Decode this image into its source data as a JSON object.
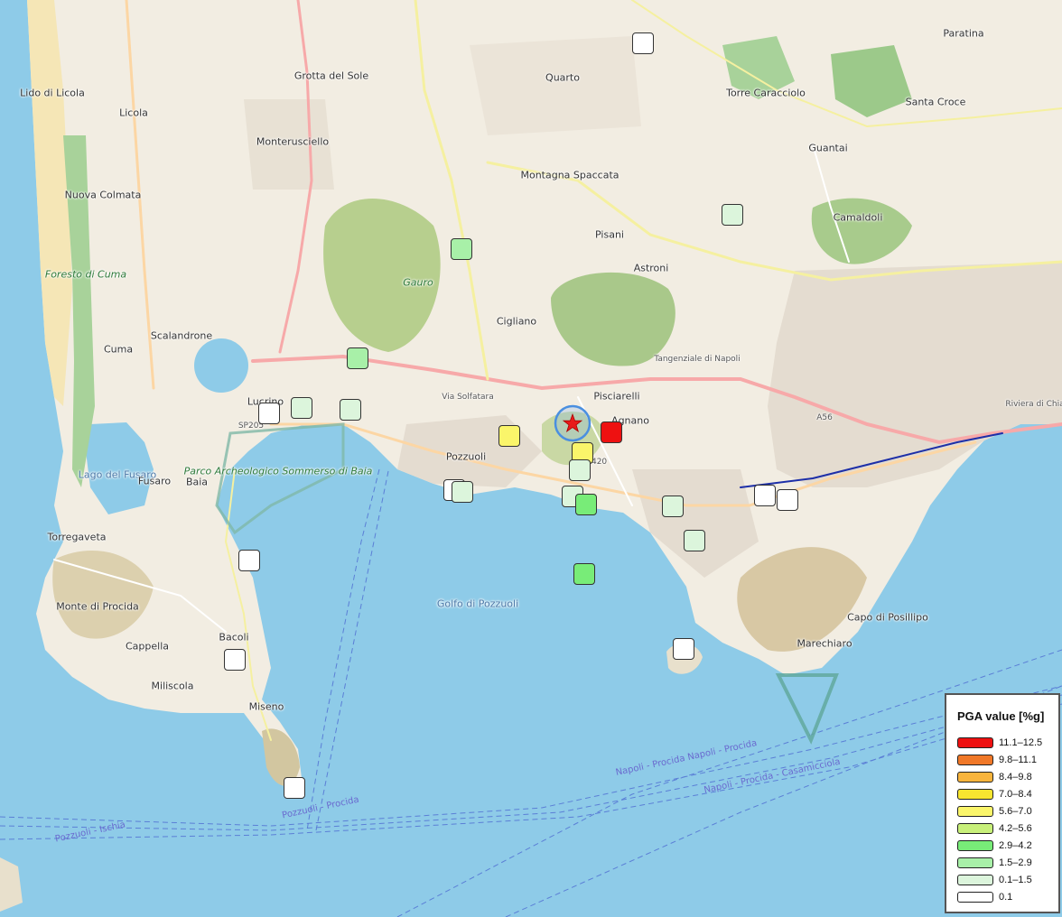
{
  "map": {
    "place_labels": [
      {
        "text": "Lido di Licola",
        "kind": "town"
      },
      {
        "text": "Licola",
        "kind": "town"
      },
      {
        "text": "Grotta del Sole",
        "kind": "town"
      },
      {
        "text": "Quarto",
        "kind": "town"
      },
      {
        "text": "Torre Caracciolo",
        "kind": "town"
      },
      {
        "text": "Paratina",
        "kind": "town"
      },
      {
        "text": "Santa Croce",
        "kind": "town"
      },
      {
        "text": "Monterusciello",
        "kind": "town"
      },
      {
        "text": "Guantai",
        "kind": "town"
      },
      {
        "text": "Montagna Spaccata",
        "kind": "town"
      },
      {
        "text": "Nuova Colmata",
        "kind": "town"
      },
      {
        "text": "Camaldoli",
        "kind": "town"
      },
      {
        "text": "Pisani",
        "kind": "town"
      },
      {
        "text": "Foresto di Cuma",
        "kind": "park"
      },
      {
        "text": "Astroni",
        "kind": "town"
      },
      {
        "text": "Gauro",
        "kind": "park"
      },
      {
        "text": "Cigliano",
        "kind": "town"
      },
      {
        "text": "Scalandrone",
        "kind": "town"
      },
      {
        "text": "Cuma",
        "kind": "town"
      },
      {
        "text": "Pisciarelli",
        "kind": "town"
      },
      {
        "text": "Lucrino",
        "kind": "town"
      },
      {
        "text": "Agnano",
        "kind": "town"
      },
      {
        "text": "Pozzuoli",
        "kind": "town"
      },
      {
        "text": "Parco Archeologico Sommerso di Baia",
        "kind": "park"
      },
      {
        "text": "Lago del Fusaro",
        "kind": "water"
      },
      {
        "text": "Fusaro",
        "kind": "town"
      },
      {
        "text": "Baia",
        "kind": "town"
      },
      {
        "text": "Torregaveta",
        "kind": "town"
      },
      {
        "text": "Golfo di Pozzuoli",
        "kind": "water"
      },
      {
        "text": "Monte di Procida",
        "kind": "town"
      },
      {
        "text": "Bacoli",
        "kind": "town"
      },
      {
        "text": "Cappella",
        "kind": "town"
      },
      {
        "text": "Capo di Posillipo",
        "kind": "town"
      },
      {
        "text": "Marechiaro",
        "kind": "town"
      },
      {
        "text": "Miliscola",
        "kind": "town"
      },
      {
        "text": "Miseno",
        "kind": "town"
      },
      {
        "text": "Napoli - Procida  Napoli - Procida",
        "kind": "route"
      },
      {
        "text": "Napoli - Procida - Casamicciola",
        "kind": "route"
      },
      {
        "text": "Pozzuoli - Ischia",
        "kind": "route"
      },
      {
        "text": "Pozzuoli - Procida",
        "kind": "route"
      },
      {
        "text": "Tangenziale di Napoli",
        "kind": "road"
      },
      {
        "text": "Via Solfatara",
        "kind": "road"
      },
      {
        "text": "SP205",
        "kind": "road"
      },
      {
        "text": "SP420",
        "kind": "road"
      },
      {
        "text": "A56",
        "kind": "road"
      },
      {
        "text": "Riviera di Chiaia",
        "kind": "road"
      }
    ],
    "epicenter": {
      "icon": "red-star-icon",
      "ring_color": "#4a8fe0",
      "star_color": "#e81b1b"
    }
  },
  "stations": [
    {
      "id": "s1",
      "pga_class": "0.1"
    },
    {
      "id": "s2",
      "pga_class": "0.1–1.5"
    },
    {
      "id": "s3",
      "pga_class": "1.5–2.9"
    },
    {
      "id": "s4",
      "pga_class": "1.5–2.9"
    },
    {
      "id": "s5",
      "pga_class": "0.1"
    },
    {
      "id": "s6",
      "pga_class": "0.1–1.5"
    },
    {
      "id": "s7",
      "pga_class": "0.1–1.5"
    },
    {
      "id": "s8",
      "pga_class": "5.6–7.0"
    },
    {
      "id": "s9",
      "pga_class": "11.1–12.5"
    },
    {
      "id": "s10",
      "pga_class": "5.6–7.0"
    },
    {
      "id": "s11",
      "pga_class": "0.1–1.5"
    },
    {
      "id": "s12",
      "pga_class": "0.1"
    },
    {
      "id": "s13",
      "pga_class": "0.1–1.5"
    },
    {
      "id": "s14",
      "pga_class": "0.1–1.5"
    },
    {
      "id": "s15",
      "pga_class": "2.9–4.2"
    },
    {
      "id": "s16",
      "pga_class": "0.1–1.5"
    },
    {
      "id": "s17",
      "pga_class": "0.1–1.5"
    },
    {
      "id": "s18",
      "pga_class": "0.1"
    },
    {
      "id": "s19",
      "pga_class": "0.1"
    },
    {
      "id": "s20",
      "pga_class": "2.9–4.2"
    },
    {
      "id": "s21",
      "pga_class": "0.1"
    },
    {
      "id": "s22",
      "pga_class": "0.1"
    },
    {
      "id": "s23",
      "pga_class": "0.1"
    },
    {
      "id": "s24",
      "pga_class": "0.1"
    }
  ],
  "legend": {
    "title": "PGA value [%g]",
    "items": [
      {
        "label": "11.1–12.5",
        "color": "#ee1111"
      },
      {
        "label": "9.8–11.1",
        "color": "#f07828"
      },
      {
        "label": "8.4–9.8",
        "color": "#f8b43c"
      },
      {
        "label": "7.0–8.4",
        "color": "#f8e630"
      },
      {
        "label": "5.6–7.0",
        "color": "#faf56a"
      },
      {
        "label": "4.2–5.6",
        "color": "#c8f07a"
      },
      {
        "label": "2.9–4.2",
        "color": "#78ec78"
      },
      {
        "label": "1.5–2.9",
        "color": "#a8f0a8"
      },
      {
        "label": "0.1–1.5",
        "color": "#dcf5dc"
      },
      {
        "label": "0.1",
        "color": "#ffffff"
      }
    ]
  }
}
